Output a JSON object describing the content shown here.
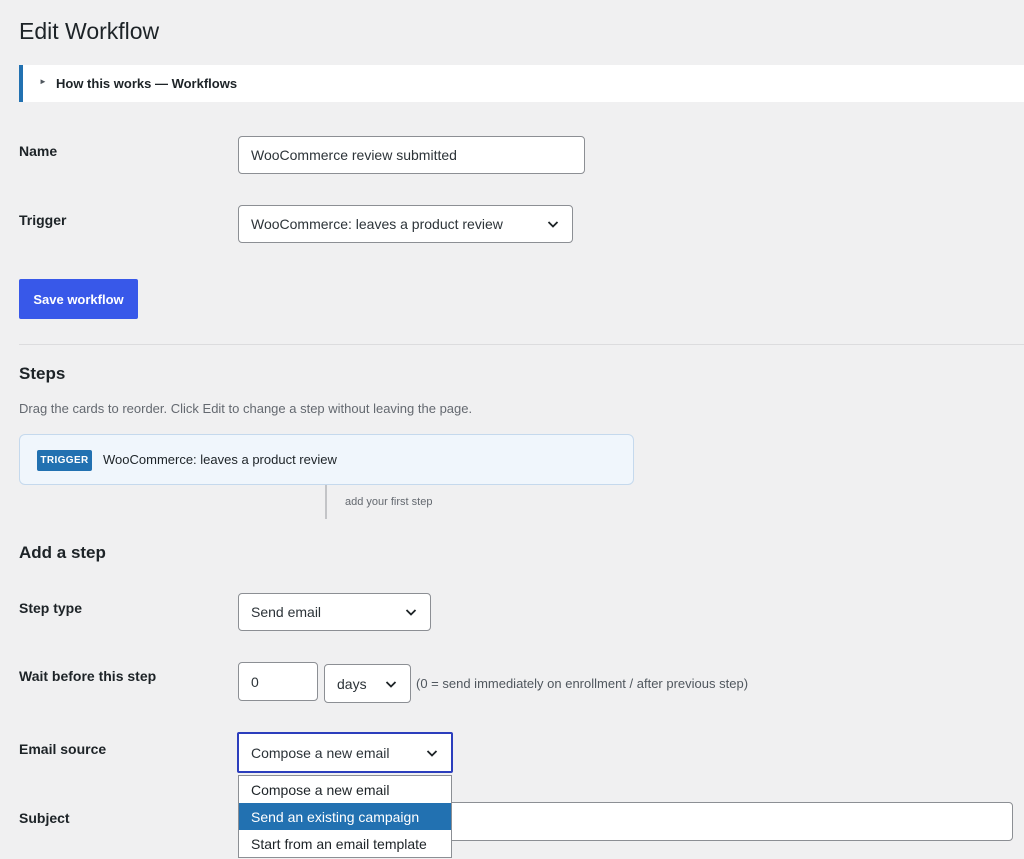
{
  "page": {
    "title": "Edit Workflow"
  },
  "howto": {
    "label": "How this works — Workflows"
  },
  "form": {
    "name_label": "Name",
    "name_value": "WooCommerce review submitted",
    "trigger_label": "Trigger",
    "trigger_value": "WooCommerce: leaves a product review",
    "save_label": "Save workflow"
  },
  "steps": {
    "heading": "Steps",
    "description": "Drag the cards to reorder. Click Edit to change a step without leaving the page.",
    "trigger_badge": "TRIGGER",
    "trigger_text": "WooCommerce: leaves a product review",
    "connector_text": "add your first step"
  },
  "add_step": {
    "heading": "Add a step",
    "step_type_label": "Step type",
    "step_type_value": "Send email",
    "wait_label": "Wait before this step",
    "wait_value": "0",
    "wait_unit": "days",
    "wait_hint": "(0 = send immediately on enrollment / after previous step)",
    "source_label": "Email source",
    "source_value": "Compose a new email",
    "source_options": [
      "Compose a new email",
      "Send an existing campaign",
      "Start from an email template"
    ],
    "source_highlighted_index": 1,
    "subject_label": "Subject",
    "subject_value": ""
  },
  "colors": {
    "accent": "#3858e9",
    "select_highlight": "#2271b1",
    "focus_border": "#2c3ebd",
    "background": "#f0f0f1"
  }
}
